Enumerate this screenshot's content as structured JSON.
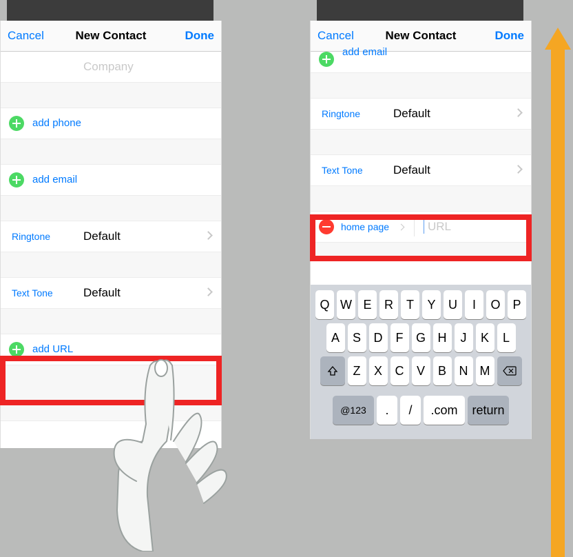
{
  "colors": {
    "ios_blue": "#007aff",
    "add_green": "#4cd964",
    "delete_red": "#ff3b30",
    "callout_red": "#ee2424",
    "arrow_orange": "#f5a623"
  },
  "left": {
    "header": {
      "cancel": "Cancel",
      "title": "New Contact",
      "done": "Done"
    },
    "company_placeholder": "Company",
    "add_phone": "add phone",
    "add_email": "add email",
    "ringtone_label": "Ringtone",
    "ringtone_value": "Default",
    "texttone_label": "Text Tone",
    "texttone_value": "Default",
    "add_url": "add URL"
  },
  "right": {
    "header": {
      "cancel": "Cancel",
      "title": "New Contact",
      "done": "Done"
    },
    "add_email": "add email",
    "ringtone_label": "Ringtone",
    "ringtone_value": "Default",
    "texttone_label": "Text Tone",
    "texttone_value": "Default",
    "url_kind": "home page",
    "url_placeholder": "URL",
    "keyboard": {
      "row1": [
        "Q",
        "W",
        "E",
        "R",
        "T",
        "Y",
        "U",
        "I",
        "O",
        "P"
      ],
      "row2": [
        "A",
        "S",
        "D",
        "F",
        "G",
        "H",
        "J",
        "K",
        "L"
      ],
      "row3": [
        "Z",
        "X",
        "C",
        "V",
        "B",
        "N",
        "M"
      ],
      "k123": "@123",
      "kdot": ".",
      "kslash": "/",
      "kcom": ".com",
      "kreturn": "return"
    }
  }
}
